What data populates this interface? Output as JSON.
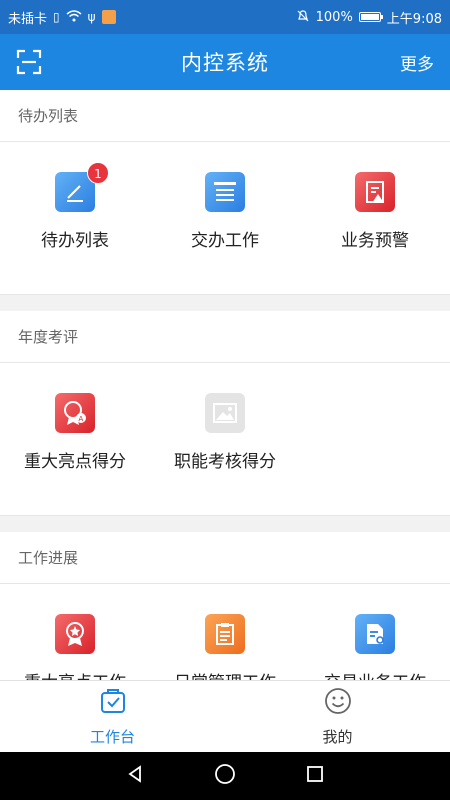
{
  "status_bar": {
    "carrier": "未插卡",
    "battery": "100%",
    "battery_level": 1.0,
    "time": "上午9:08"
  },
  "header": {
    "title": "内控系统",
    "more_label": "更多",
    "scan_icon": "scan-icon"
  },
  "sections": [
    {
      "title": "待办列表",
      "items": [
        {
          "label": "待办列表",
          "icon": "edit-icon",
          "badge": "1"
        },
        {
          "label": "交办工作",
          "icon": "assign-doc-icon"
        },
        {
          "label": "业务预警",
          "icon": "warning-doc-icon"
        }
      ]
    },
    {
      "title": "年度考评",
      "items": [
        {
          "label": "重大亮点得分",
          "icon": "award-a-icon"
        },
        {
          "label": "职能考核得分",
          "icon": "image-placeholder-icon"
        }
      ]
    },
    {
      "title": "工作进展",
      "items": [
        {
          "label": "重大亮点工作",
          "icon": "award-star-icon"
        },
        {
          "label": "日常管理工作",
          "icon": "clipboard-icon"
        },
        {
          "label": "交易业务工作",
          "icon": "document-search-icon"
        }
      ]
    }
  ],
  "tabbar": {
    "tabs": [
      {
        "label": "工作台",
        "icon": "workbench-icon",
        "active": true
      },
      {
        "label": "我的",
        "icon": "smiley-icon",
        "active": false
      }
    ]
  },
  "colors": {
    "primary": "#1d86e0",
    "status_bar": "#1f6fc4",
    "badge": "#e8343c"
  }
}
